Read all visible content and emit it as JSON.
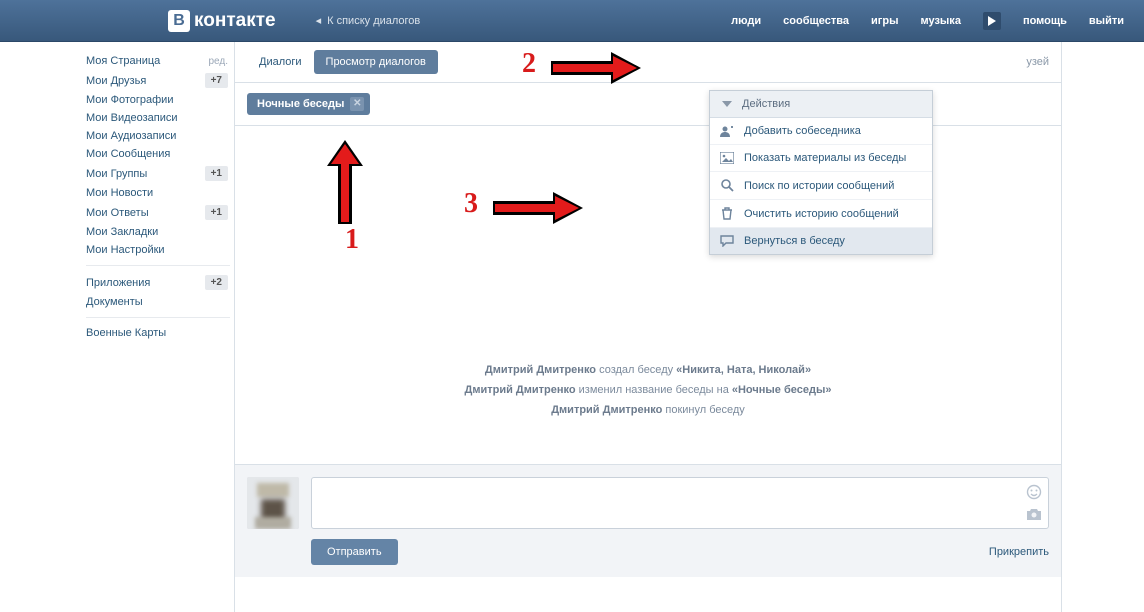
{
  "header": {
    "brand_letter": "В",
    "brand_text": "контакте",
    "back_label": "К списку диалогов",
    "nav": [
      "люди",
      "сообщества",
      "игры",
      "музыка"
    ],
    "nav_right": [
      "помощь",
      "выйти"
    ]
  },
  "sidebar": {
    "edit_label": "ред.",
    "groups": [
      [
        {
          "label": "Моя Страница",
          "count": null,
          "edit": true
        },
        {
          "label": "Мои Друзья",
          "count": "+7"
        },
        {
          "label": "Мои Фотографии",
          "count": null
        },
        {
          "label": "Мои Видеозаписи",
          "count": null
        },
        {
          "label": "Мои Аудиозаписи",
          "count": null
        },
        {
          "label": "Мои Сообщения",
          "count": null
        },
        {
          "label": "Мои Группы",
          "count": "+1"
        },
        {
          "label": "Мои Новости",
          "count": null
        },
        {
          "label": "Мои Ответы",
          "count": "+1"
        },
        {
          "label": "Мои Закладки",
          "count": null
        },
        {
          "label": "Мои Настройки",
          "count": null
        }
      ],
      [
        {
          "label": "Приложения",
          "count": "+2"
        },
        {
          "label": "Документы",
          "count": null
        }
      ],
      [
        {
          "label": "Военные Карты",
          "count": null
        }
      ]
    ]
  },
  "tabs": {
    "items": [
      "Диалоги",
      "Просмотр диалогов"
    ],
    "active_index": 1,
    "right_label_suffix": "узей"
  },
  "chat": {
    "chip_label": "Ночные беседы"
  },
  "dropdown": {
    "header": "Действия",
    "items": [
      {
        "icon": "user-plus",
        "label": "Добавить собеседника"
      },
      {
        "icon": "image",
        "label": "Показать материалы из беседы"
      },
      {
        "icon": "search",
        "label": "Поиск по истории сообщений"
      },
      {
        "icon": "trash",
        "label": "Очистить историю сообщений"
      },
      {
        "icon": "chat",
        "label": "Вернуться в беседу",
        "highlight": true
      }
    ]
  },
  "annotations": {
    "one": "1",
    "two": "2",
    "three": "3"
  },
  "feed": {
    "actor": "Дмитрий Дмитренко",
    "line1_mid": " создал беседу ",
    "line1_obj": "«Никита, Ната, Николай»",
    "line2_mid": " изменил название беседы на ",
    "line2_obj": "«Ночные беседы»",
    "line3_tail": " покинул беседу"
  },
  "compose": {
    "send_label": "Отправить",
    "attach_label": "Прикрепить"
  }
}
